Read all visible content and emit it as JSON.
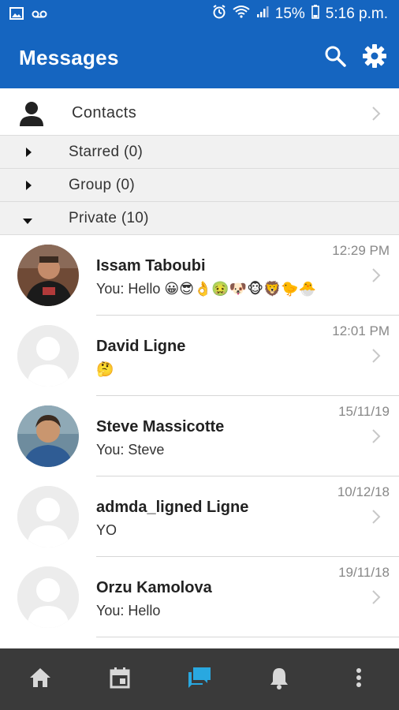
{
  "status_bar": {
    "battery": "15%",
    "time": "5:16 p.m.",
    "icons": [
      "image-icon",
      "voicemail-icon",
      "alarm-icon",
      "wifi-call-icon",
      "signal-icon",
      "battery-icon"
    ]
  },
  "header": {
    "title": "Messages",
    "actions": [
      "search-icon",
      "settings-gear-icon"
    ],
    "color": "#1565c0"
  },
  "contacts": {
    "label": "Contacts"
  },
  "groups": [
    {
      "label": "Starred (0)",
      "expanded": false
    },
    {
      "label": "Group (0)",
      "expanded": false
    },
    {
      "label": "Private (10)",
      "expanded": true
    }
  ],
  "messages": [
    {
      "name": "Issam Taboubi",
      "prefix": "You:",
      "preview": "Hello 😀😎👌🤢🐶🐵🦁🐤🐣",
      "time": "12:29 PM",
      "avatar": "photo"
    },
    {
      "name": "David Ligne",
      "prefix": "",
      "preview": "🤔",
      "time": "12:01 PM",
      "avatar": "placeholder"
    },
    {
      "name": "Steve Massicotte",
      "prefix": "You:",
      "preview": "Steve",
      "time": "15/11/19",
      "avatar": "photo"
    },
    {
      "name": "admda_ligned Ligne",
      "prefix": "",
      "preview": "YO",
      "time": "10/12/18",
      "avatar": "placeholder"
    },
    {
      "name": "Orzu Kamolova",
      "prefix": "You:",
      "preview": "Hello",
      "time": "19/11/18",
      "avatar": "placeholder"
    }
  ],
  "bottom_nav": [
    "home-icon",
    "calendar-icon",
    "messages-icon",
    "notifications-bell-icon",
    "more-vertical-icon"
  ],
  "active_nav": "messages-icon",
  "accent_color": "#29a8e0"
}
